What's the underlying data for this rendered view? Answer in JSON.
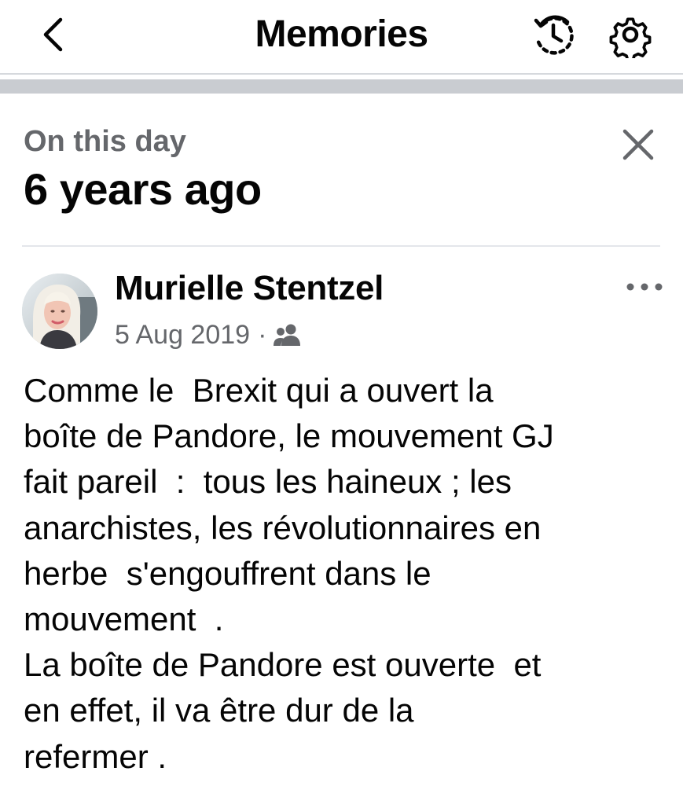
{
  "header": {
    "title": "Memories",
    "back_icon": "chevron-left-icon",
    "history_icon": "history-icon",
    "settings_icon": "gear-icon"
  },
  "memory": {
    "label": "On this day",
    "heading": "6 years ago",
    "close_icon": "close-icon"
  },
  "post": {
    "author": "Murielle Stentzel",
    "date": "5 Aug 2019",
    "separator": "·",
    "audience_icon": "friends-icon",
    "more_icon": "more-horizontal-icon",
    "text": "Comme le  Brexit qui a ouvert la\nboîte de Pandore, le mouvement GJ\nfait pareil  :  tous les haineux ; les\nanarchistes, les révolutionnaires en\nherbe  s'engouffrent dans le\nmouvement  .\nLa boîte de Pandore est ouverte  et\nen effet, il va être dur de la\nrefermer ."
  },
  "colors": {
    "primary_text": "#050505",
    "secondary_text": "#65676b",
    "divider": "#c9ccd1"
  }
}
